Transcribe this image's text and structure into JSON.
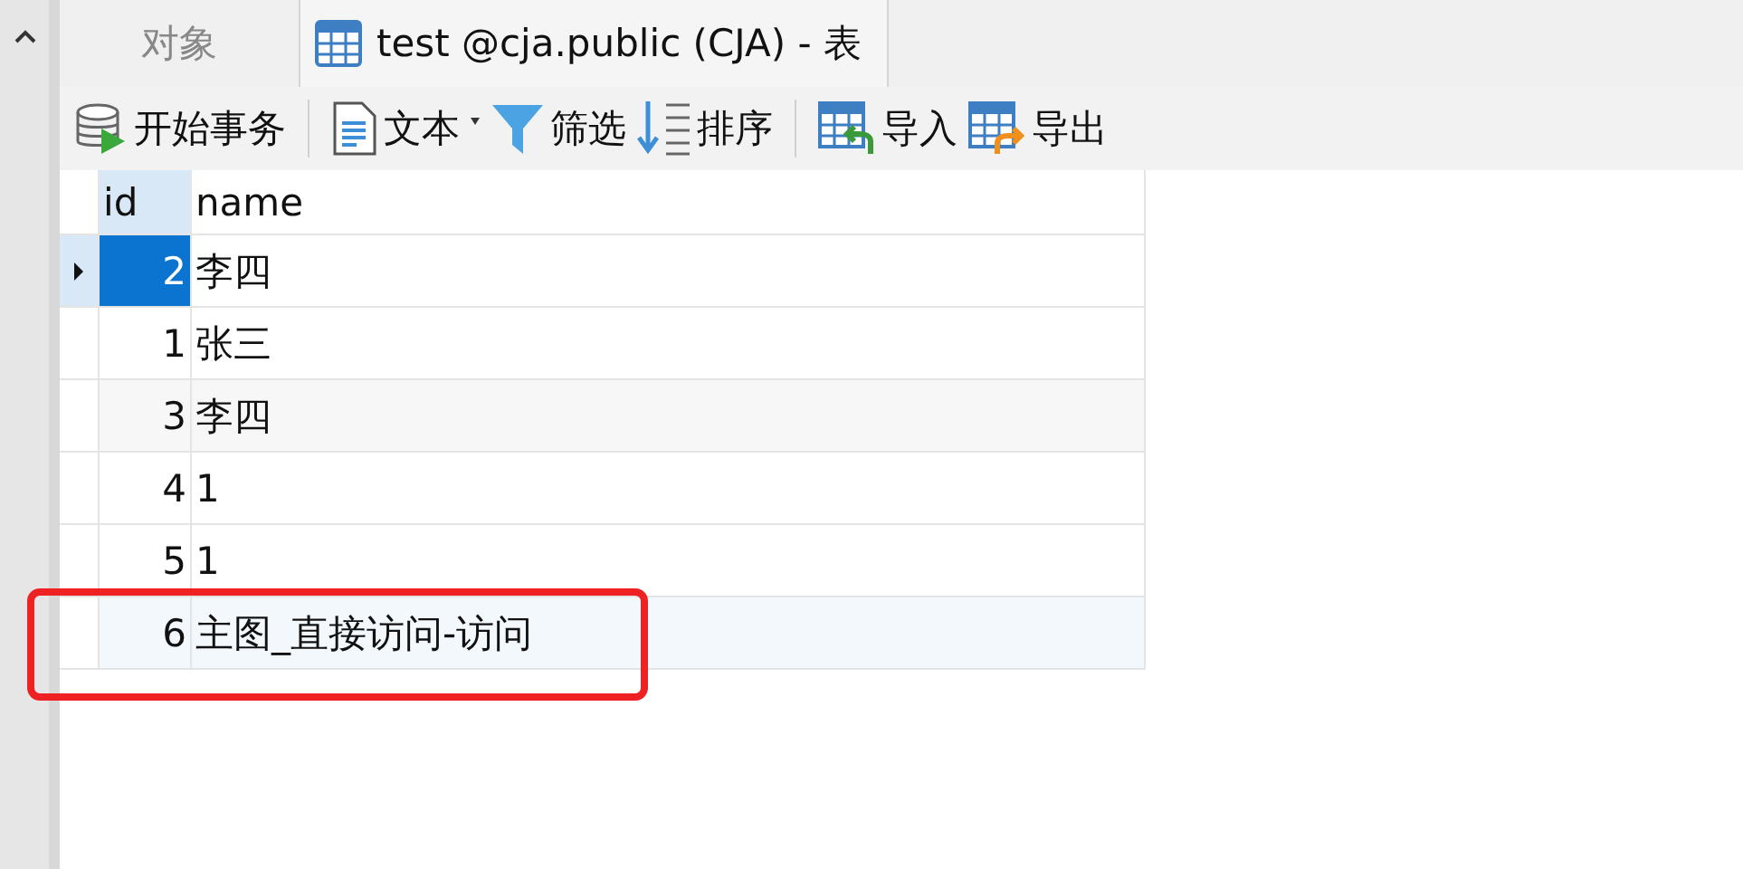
{
  "tabs": [
    {
      "label": "对象",
      "selected": false,
      "kind": "plain"
    },
    {
      "label": "test @cja.public (CJA) - 表",
      "selected": true,
      "kind": "table"
    }
  ],
  "toolbar": [
    [
      {
        "label": "开始事务",
        "kind": "transaction",
        "dropdown": false
      }
    ],
    [
      {
        "label": "文本",
        "kind": "text",
        "dropdown": true
      },
      {
        "label": "筛选",
        "kind": "filter",
        "dropdown": false
      },
      {
        "label": "排序",
        "kind": "sort",
        "dropdown": false
      }
    ],
    [
      {
        "label": "导入",
        "kind": "import",
        "dropdown": false
      },
      {
        "label": "导出",
        "kind": "export",
        "dropdown": false
      }
    ]
  ],
  "table": {
    "columns": [
      "id",
      "name"
    ],
    "rows": [
      {
        "cells": [
          "2",
          "李四"
        ],
        "selected": true,
        "highlighted": false
      },
      {
        "cells": [
          "1",
          "张三"
        ],
        "selected": false,
        "highlighted": false
      },
      {
        "cells": [
          "3",
          "李四"
        ],
        "selected": false,
        "highlighted": false
      },
      {
        "cells": [
          "4",
          "1"
        ],
        "selected": false,
        "highlighted": false
      },
      {
        "cells": [
          "5",
          "1"
        ],
        "selected": false,
        "highlighted": false
      },
      {
        "cells": [
          "6",
          "主图_直接访问-访问"
        ],
        "selected": false,
        "highlighted": true
      }
    ]
  }
}
